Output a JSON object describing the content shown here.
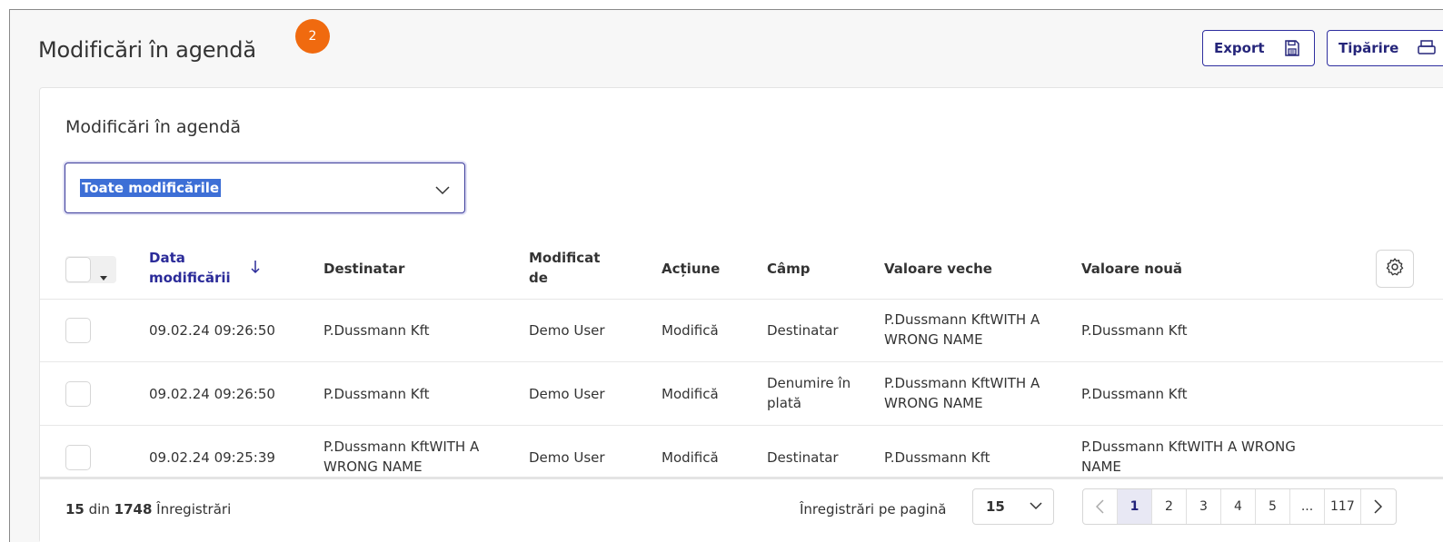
{
  "header": {
    "title": "Modificări în agendă",
    "step_badge": "2",
    "export_label": "Export",
    "print_label": "Tipărire"
  },
  "card": {
    "title": "Modificări în agendă",
    "filter": {
      "selected": "Toate modificările"
    }
  },
  "table": {
    "columns": {
      "date": [
        "Data",
        "modificării"
      ],
      "recipient": "Destinatar",
      "modified_by": [
        "Modificat",
        "de"
      ],
      "action": "Acțiune",
      "field": "Câmp",
      "old_value": "Valoare veche",
      "new_value": "Valoare nouă"
    },
    "rows": [
      {
        "date": "09.02.24 09:26:50",
        "recipient": [
          "P.Dussmann Kft"
        ],
        "modified_by": "Demo User",
        "action": "Modifică",
        "field": [
          "Destinatar"
        ],
        "old_value": [
          "P.Dussmann KftWITH A",
          "WRONG NAME"
        ],
        "new_value": [
          "P.Dussmann Kft"
        ]
      },
      {
        "date": "09.02.24 09:26:50",
        "recipient": [
          "P.Dussmann Kft"
        ],
        "modified_by": "Demo User",
        "action": "Modifică",
        "field": [
          "Denumire în",
          "plată"
        ],
        "old_value": [
          "P.Dussmann KftWITH A",
          "WRONG NAME"
        ],
        "new_value": [
          "P.Dussmann Kft"
        ]
      },
      {
        "date": "09.02.24 09:25:39",
        "recipient": [
          "P.Dussmann KftWITH A",
          "WRONG NAME"
        ],
        "modified_by": "Demo User",
        "action": "Modifică",
        "field": [
          "Destinatar"
        ],
        "old_value": [
          "P.Dussmann Kft"
        ],
        "new_value": [
          "P.Dussmann KftWITH A WRONG",
          "NAME"
        ]
      }
    ]
  },
  "footer": {
    "shown": "15",
    "of": "din",
    "total": "1748",
    "records_word": "Înregistrări",
    "per_page_label": "Înregistrări pe pagină",
    "per_page_value": "15",
    "pages": [
      "1",
      "2",
      "3",
      "4",
      "5",
      "...",
      "117"
    ],
    "current_page": "1"
  },
  "colors": {
    "accent": "#2b2b99",
    "badge": "#f06a0f",
    "selection": "#3d6fd6"
  }
}
